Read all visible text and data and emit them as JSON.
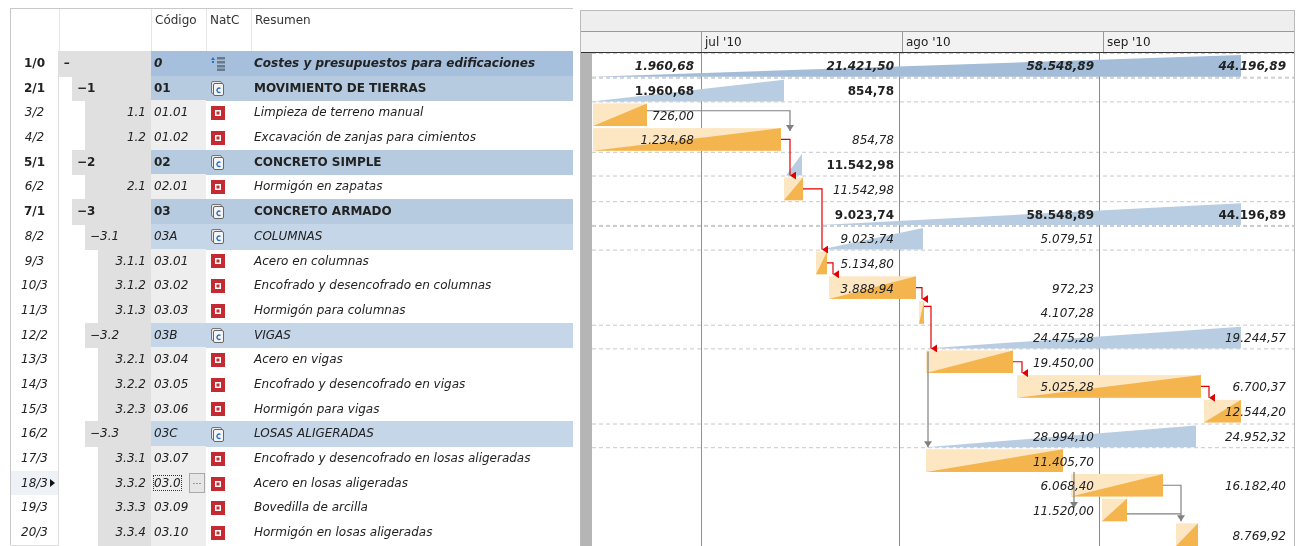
{
  "table": {
    "columns": [
      "Código",
      "NatC",
      "Resumen"
    ]
  },
  "gantt": {
    "months": [
      "jul '10",
      "ago '10",
      "sep '10"
    ]
  },
  "rows": [
    {
      "index": "1/0",
      "toggle": "–",
      "code": "0",
      "kind": "root",
      "summary": "Costes y presupuestos para edificaciones",
      "selected": false,
      "gantt_values": [
        "1.960,68",
        "21.421,50",
        "58.548,89",
        "44.196,89"
      ],
      "children": [
        {
          "index": "2/1",
          "toggle": "−",
          "number": "1",
          "code": "01",
          "kind": "chapter",
          "summary": "MOVIMIENTO DE TIERRAS",
          "selected": false,
          "gantt_values": [
            "1.960,68",
            "854,78"
          ],
          "children": [
            {
              "index": "3/2",
              "number": "1.1",
              "code": "01.01",
              "kind": "item",
              "summary": "Limpieza de terreno manual",
              "selected": false,
              "gantt_values": [
                "726,00"
              ]
            },
            {
              "index": "4/2",
              "number": "1.2",
              "code": "01.02",
              "kind": "item",
              "summary": "Excavación de zanjas para cimientos",
              "selected": false,
              "gantt_values": [
                "1.234,68",
                "854,78"
              ]
            }
          ]
        },
        {
          "index": "5/1",
          "toggle": "−",
          "number": "2",
          "code": "02",
          "kind": "chapter",
          "summary": "CONCRETO SIMPLE",
          "selected": false,
          "gantt_values": [
            "11.542,98"
          ],
          "children": [
            {
              "index": "6/2",
              "number": "2.1",
              "code": "02.01",
              "kind": "item",
              "summary": "Hormigón en zapatas",
              "selected": false,
              "gantt_values": [
                "11.542,98"
              ]
            }
          ]
        },
        {
          "index": "7/1",
          "toggle": "−",
          "number": "3",
          "code": "03",
          "kind": "chapter",
          "summary": "CONCRETO ARMADO",
          "selected": false,
          "gantt_values": [
            "9.023,74",
            "58.548,89",
            "44.196,89"
          ],
          "children": [
            {
              "index": "8/2",
              "toggle": "−",
              "number": "3.1",
              "code": "03A",
              "kind": "subchapter",
              "summary": "COLUMNAS",
              "selected": false,
              "gantt_values": [
                "9.023,74",
                "5.079,51"
              ],
              "children": [
                {
                  "index": "9/3",
                  "number": "3.1.1",
                  "code": "03.01",
                  "kind": "item",
                  "summary": "Acero en columnas",
                  "selected": false,
                  "gantt_values": [
                    "5.134,80"
                  ]
                },
                {
                  "index": "10/3",
                  "number": "3.1.2",
                  "code": "03.02",
                  "kind": "item",
                  "summary": "Encofrado y desencofrado en columnas",
                  "selected": false,
                  "gantt_values": [
                    "3.888,94",
                    "972,23"
                  ]
                },
                {
                  "index": "11/3",
                  "number": "3.1.3",
                  "code": "03.03",
                  "kind": "item",
                  "summary": "Hormigón para columnas",
                  "selected": false,
                  "gantt_values": [
                    "4.107,28"
                  ]
                }
              ]
            },
            {
              "index": "12/2",
              "toggle": "−",
              "number": "3.2",
              "code": "03B",
              "kind": "subchapter",
              "summary": "VIGAS",
              "selected": false,
              "gantt_values": [
                "24.475,28",
                "19.244,57"
              ],
              "children": [
                {
                  "index": "13/3",
                  "number": "3.2.1",
                  "code": "03.04",
                  "kind": "item",
                  "summary": "Acero en vigas",
                  "selected": false,
                  "gantt_values": [
                    "19.450,00"
                  ]
                },
                {
                  "index": "14/3",
                  "number": "3.2.2",
                  "code": "03.05",
                  "kind": "item",
                  "summary": "Encofrado y desencofrado en vigas",
                  "selected": false,
                  "gantt_values": [
                    "5.025,28",
                    "6.700,37"
                  ]
                },
                {
                  "index": "15/3",
                  "number": "3.2.3",
                  "code": "03.06",
                  "kind": "item",
                  "summary": "Hormigón para vigas",
                  "selected": false,
                  "gantt_values": [
                    "12.544,20"
                  ]
                }
              ]
            },
            {
              "index": "16/2",
              "toggle": "−",
              "number": "3.3",
              "code": "03C",
              "kind": "subchapter",
              "summary": "LOSAS ALIGERADAS",
              "selected": false,
              "gantt_values": [
                "28.994,10",
                "24.952,32"
              ],
              "children": [
                {
                  "index": "17/3",
                  "number": "3.3.1",
                  "code": "03.07",
                  "kind": "item",
                  "summary": "Encofrado y desencofrado en losas aligeradas",
                  "selected": false,
                  "gantt_values": [
                    "11.405,70"
                  ]
                },
                {
                  "index": "18/3",
                  "number": "3.3.2",
                  "code": "03.0",
                  "edit_button": "···",
                  "kind": "item",
                  "summary": "Acero en losas aligeradas",
                  "selected": true,
                  "gantt_values": [
                    "6.068,40",
                    "16.182,40"
                  ]
                },
                {
                  "index": "19/3",
                  "number": "3.3.3",
                  "code": "03.09",
                  "kind": "item",
                  "summary": "Bovedilla de arcilla",
                  "selected": false,
                  "gantt_values": [
                    "11.520,00"
                  ]
                },
                {
                  "index": "20/3",
                  "number": "3.3.4",
                  "code": "03.10",
                  "kind": "item",
                  "summary": "Hormigón en losas aligeradas",
                  "selected": false,
                  "gantt_values": [
                    "8.769,92"
                  ]
                }
              ]
            }
          ]
        }
      ]
    }
  ]
}
